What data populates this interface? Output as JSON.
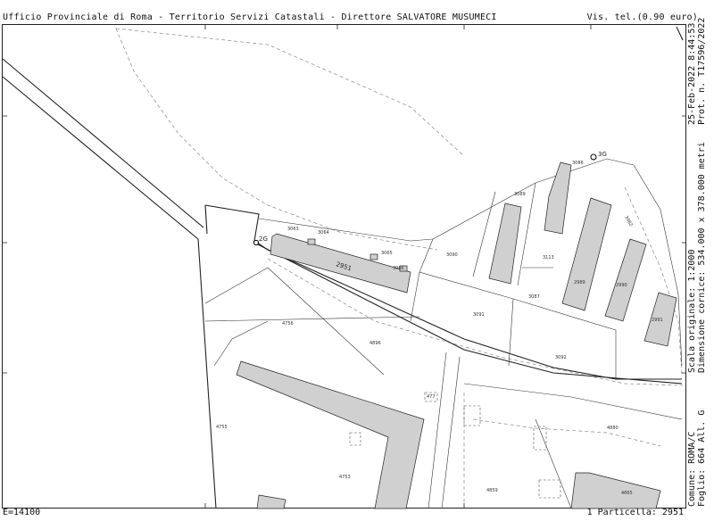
{
  "header": {
    "office": "Ufficio Provinciale di Roma - Territorio Servizi Catastali - Direttore SALVATORE MUSUMECI",
    "visura": "Vis. tel.(0.90 euro)"
  },
  "side_panel": {
    "date": "25-Feb-2022 8:44:53",
    "prot": "Prot. n. T17596/2022",
    "scale": "Scala originale: 1:2000",
    "dimension": "Dimensione cornice: 534.000 x 378.000 metri",
    "comune": "Comune: ROMA/C",
    "foglio": "Foglio: 664 All. G"
  },
  "footer": {
    "east": "E=14100",
    "particle": "1 Particella: 2951"
  },
  "markers": {
    "point_a": "2G",
    "point_b": "3G"
  },
  "parcels": {
    "main": "2951",
    "p3063": "3063",
    "p3064": "3064",
    "p3065": "3065",
    "p3066": "3066",
    "p3090": "3090",
    "p3091": "3091",
    "p3092": "3092",
    "p3089": "3089",
    "p3086": "3086",
    "p3087": "3087",
    "p3113": "3113",
    "p2989": "2989",
    "p2990": "2990",
    "p2991": "2991",
    "p3982": "3982",
    "p4756": "4756",
    "p4896": "4896",
    "p4755": "4755",
    "p4753": "4753",
    "p4859": "4859",
    "p4880": "4880",
    "p4865": "4865",
    "p477": "477"
  },
  "colors": {
    "building_fill": "#d0d0d0",
    "line": "#222222",
    "dashed": "#888888"
  }
}
